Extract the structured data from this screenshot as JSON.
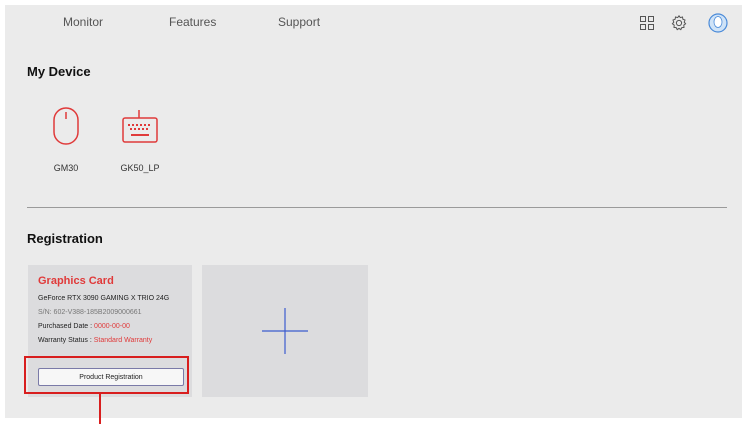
{
  "nav": {
    "items": [
      "Monitor",
      "Features",
      "Support"
    ]
  },
  "icons": {
    "grid": "grid-icon",
    "settings": "gear-icon",
    "avatar": "user-avatar-icon"
  },
  "my_device": {
    "title": "My Device",
    "devices": [
      {
        "name": "GM30",
        "icon": "mouse-icon"
      },
      {
        "name": "GK50_LP",
        "icon": "keyboard-icon"
      }
    ]
  },
  "registration": {
    "title": "Registration",
    "card": {
      "category": "Graphics Card",
      "product": "GeForce RTX 3090 GAMING X TRIO 24G",
      "serial": "S/N: 602-V388-185B2009000661",
      "purchased_label": "Purchased Date :",
      "purchased_value": "0000-00-00",
      "warranty_label": "Warranty Status :",
      "warranty_value": "Standard Warranty",
      "button_label": "Product Registration"
    },
    "add_icon": "plus-icon"
  },
  "colors": {
    "accent_red": "#e03a3a",
    "highlight_red": "#d81e1e",
    "plus_blue": "#3b5bcf",
    "panel_bg": "#ebebeb",
    "card_bg": "#dcdcde"
  }
}
